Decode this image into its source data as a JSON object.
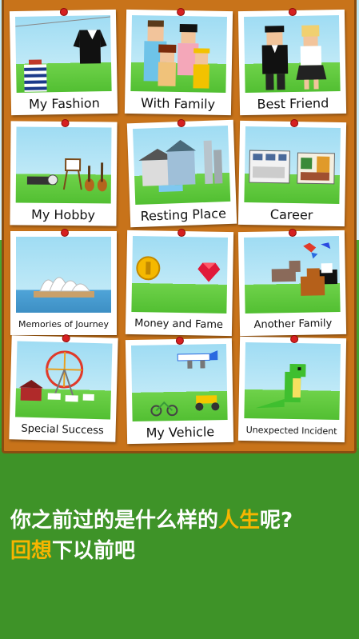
{
  "cards": [
    {
      "label": "My Fashion"
    },
    {
      "label": "With Family"
    },
    {
      "label": "Best Friend"
    },
    {
      "label": "My Hobby"
    },
    {
      "label": "Resting Place"
    },
    {
      "label": "Career"
    },
    {
      "label": "Memories of Journey"
    },
    {
      "label": "Money and Fame"
    },
    {
      "label": "Another Family"
    },
    {
      "label": "Special Success"
    },
    {
      "label": "My Vehicle"
    },
    {
      "label": "Unexpected Incident"
    }
  ],
  "caption": {
    "line1_part1": "你之前过的是什么样的",
    "line1_highlight": "人生",
    "line1_part2": "呢?",
    "line2_highlight": "回想",
    "line2_part2": "下以前吧"
  },
  "colors": {
    "board": "#c8731a",
    "highlight": "#f7b500",
    "pin": "#d62020",
    "ground": "#3e9328"
  }
}
